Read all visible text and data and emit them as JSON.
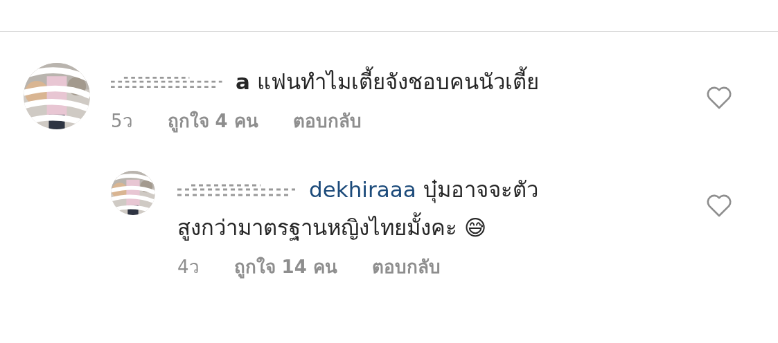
{
  "comments": [
    {
      "kind": "comment",
      "name_tail": "a",
      "text_lines": [
        "แฟนทำไมเตี้ยจังชอบคนนัวเตี้ย"
      ],
      "time": "5ว",
      "likes": "ถูกใจ 4 คน",
      "reply": "ตอบกลับ",
      "liked": false
    },
    {
      "kind": "reply",
      "mention": "dekhiraaa",
      "text_lines": [
        "บุ๋มอาจจะตัว",
        "สูงกว่ามาตรฐานหญิงไทยมั้งคะ 😅"
      ],
      "time": "4ว",
      "likes": "ถูกใจ 14 คน",
      "reply": "ตอบกลับ",
      "liked": false
    }
  ]
}
